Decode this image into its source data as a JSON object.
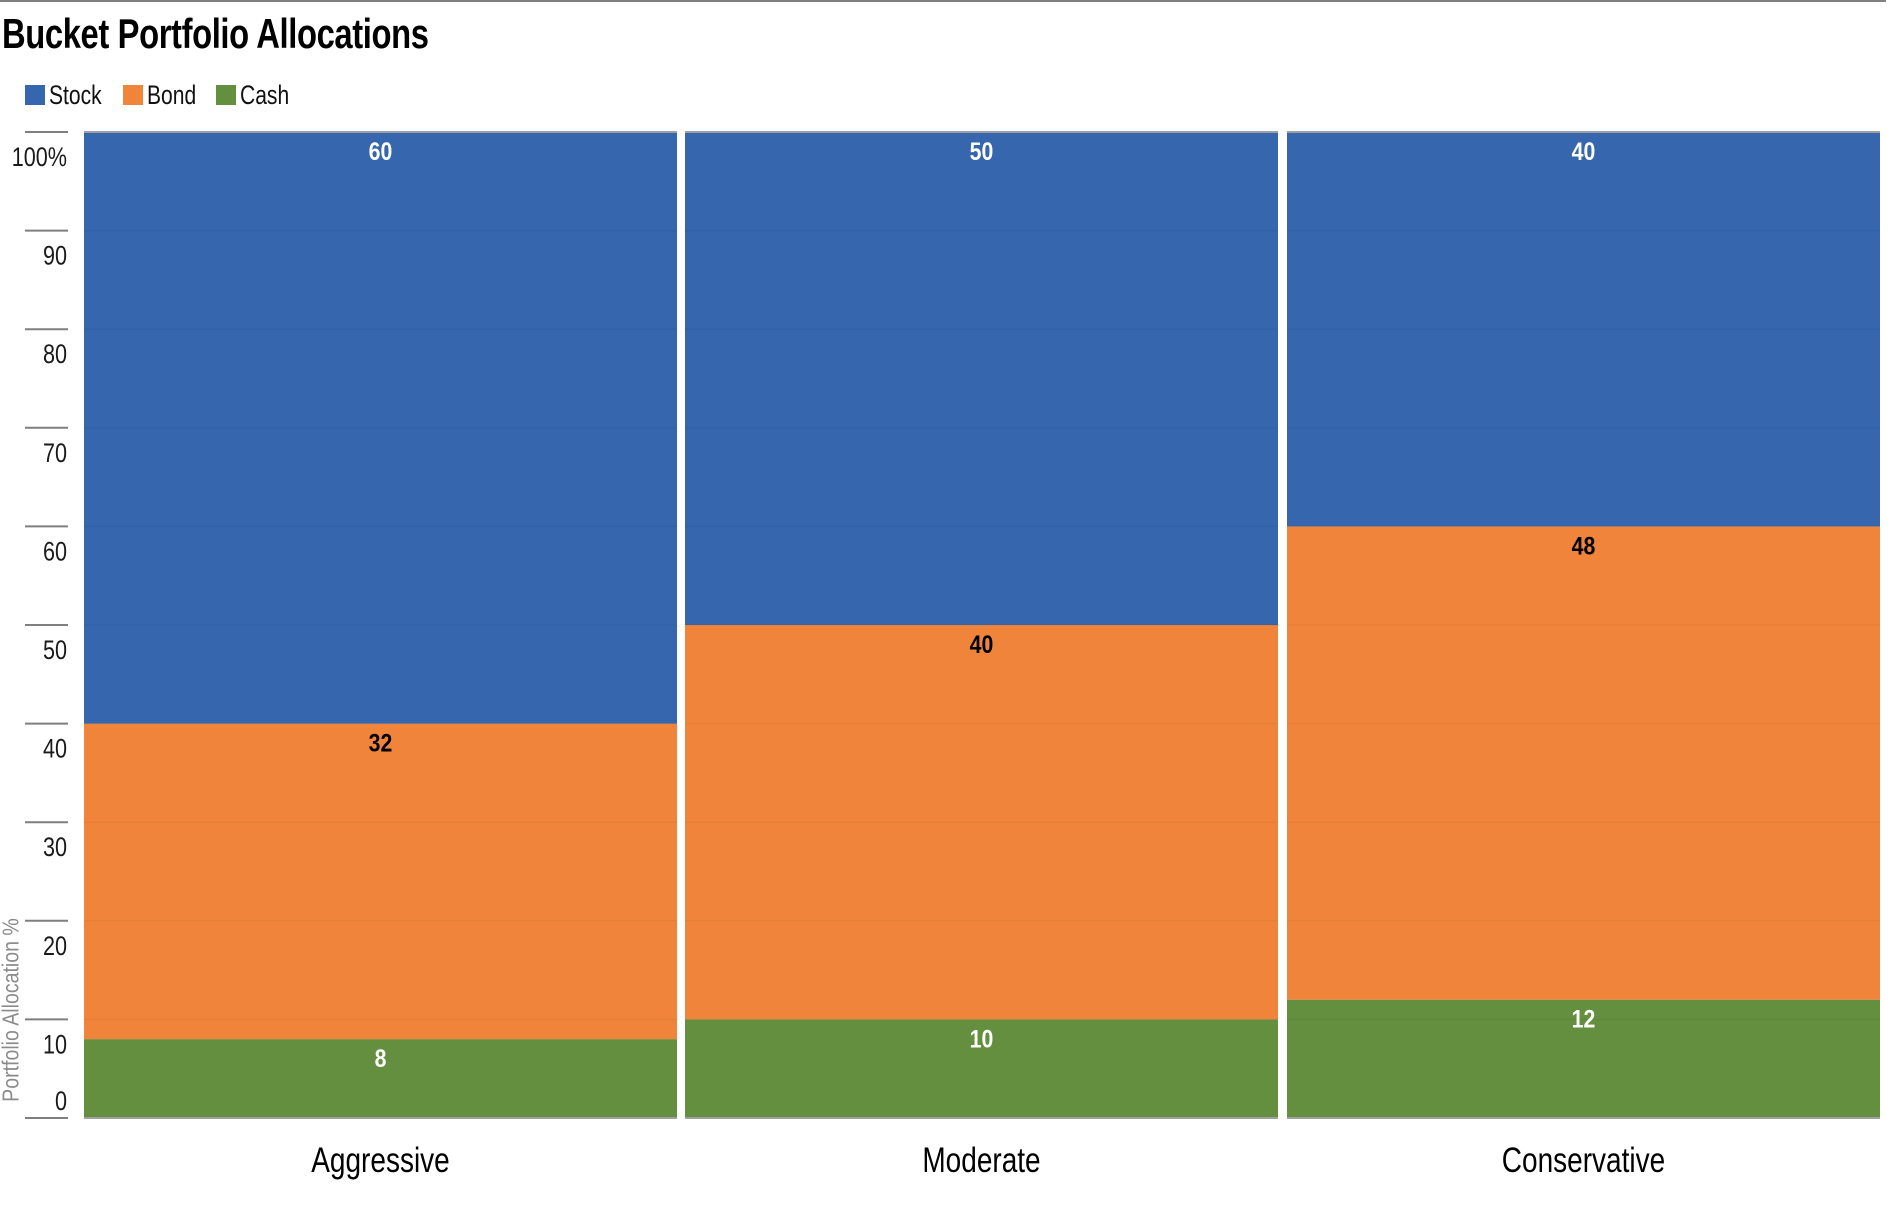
{
  "title": "Bucket Portfolio Allocations",
  "colors": {
    "Stock": "#3566ae",
    "Bond": "#f0843a",
    "Cash": "#638f3f",
    "axis": "#7f7f7f",
    "label_on_dark": "#ffffff",
    "label_on_light": "#000000"
  },
  "legend": {
    "items": [
      {
        "label": "Stock",
        "color": "#3566ae"
      },
      {
        "label": "Bond",
        "color": "#f0843a"
      },
      {
        "label": "Cash",
        "color": "#638f3f"
      }
    ]
  },
  "chart_data": {
    "type": "bar",
    "stacked": true,
    "title": "Bucket Portfolio Allocations",
    "xlabel": "",
    "ylabel": "Portfolio Allocation %",
    "categories": [
      "Aggressive",
      "Moderate",
      "Conservative"
    ],
    "series": [
      {
        "name": "Cash",
        "values": [
          8,
          10,
          12
        ]
      },
      {
        "name": "Bond",
        "values": [
          32,
          40,
          48
        ]
      },
      {
        "name": "Stock",
        "values": [
          60,
          50,
          40
        ]
      }
    ],
    "ylim": [
      0,
      100
    ],
    "yticks": [
      0,
      10,
      20,
      30,
      40,
      50,
      60,
      70,
      80,
      90,
      100
    ],
    "ytick_labels": [
      "0",
      "10",
      "20",
      "30",
      "40",
      "50",
      "60",
      "70",
      "80",
      "90",
      "100%"
    ],
    "grid": true,
    "legend_position": "top-left",
    "data_labels": true
  }
}
